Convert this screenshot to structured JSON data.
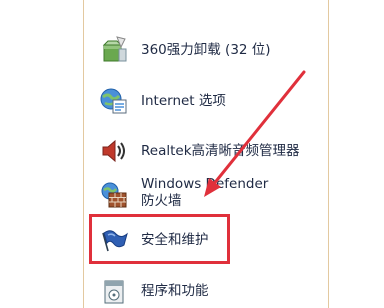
{
  "items": [
    {
      "label": "360强力卸载 (32 位)",
      "icon": "uninstall-box-icon"
    },
    {
      "label": "Internet 选项",
      "icon": "internet-options-icon"
    },
    {
      "label": "Realtek高清晰音频管理器",
      "icon": "speaker-icon"
    },
    {
      "label": "Windows Defender 防火墙",
      "icon": "firewall-icon"
    },
    {
      "label": "安全和维护",
      "icon": "security-flag-icon"
    },
    {
      "label": "程序和功能",
      "icon": "programs-icon"
    }
  ],
  "colors": {
    "highlight": "#e0303b",
    "arrow": "#e0303b",
    "text": "#1f2a44"
  }
}
